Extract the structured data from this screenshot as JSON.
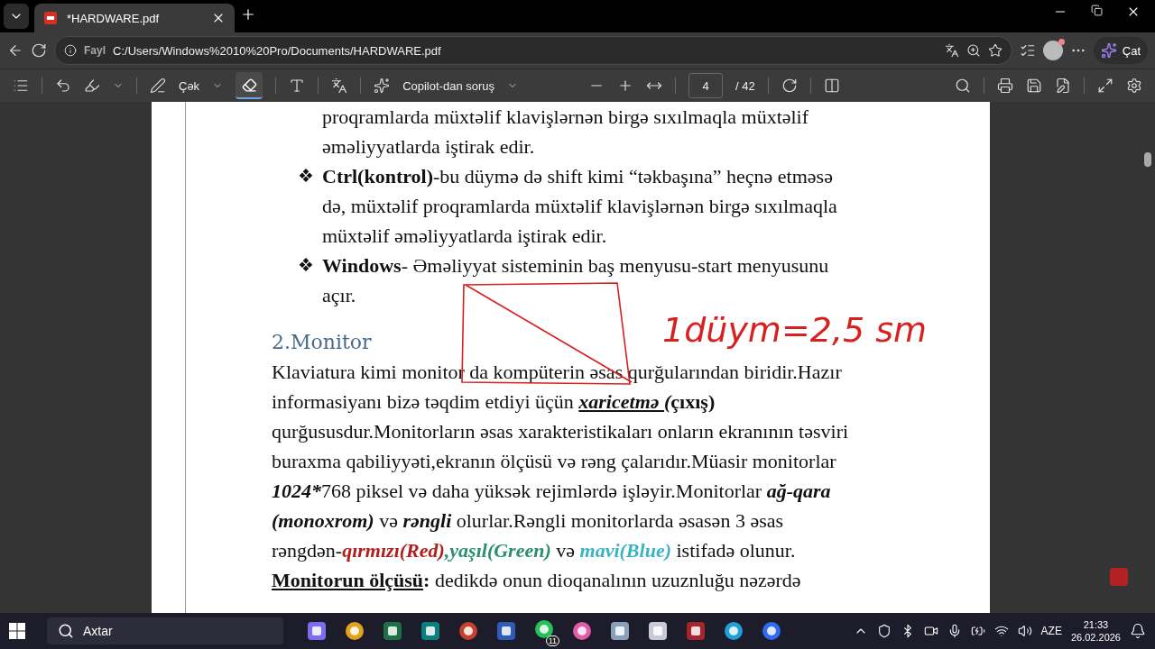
{
  "tabs": [
    {
      "title": "*HARDWARE.pdf",
      "selected": true
    }
  ],
  "address": {
    "label": "Fayl",
    "url": "C:/Users/Windows%2010%20Pro/Documents/HARDWARE.pdf"
  },
  "copilot_button": {
    "label": "Çat"
  },
  "pdf_toolbar": {
    "draw_label": "Çək",
    "eraser_selected": true,
    "ask_label": "Copilot-dan soruş",
    "page": "4",
    "page_total": "/ 42"
  },
  "document": {
    "blocks": [
      {
        "kind": "continuation",
        "lines": [
          [
            {
              "text": "proqramlarda müxtəlif klavişlərnən birgə sıxılmaqla müxtəlif",
              "bold": false,
              "italic": false,
              "underline": false
            }
          ],
          [
            {
              "text": "əməliyyatlarda iştirak edir.",
              "bold": false,
              "italic": false,
              "underline": false
            }
          ]
        ]
      },
      {
        "kind": "bullet",
        "symbol": "❖",
        "lines": [
          [
            {
              "text": "Ctrl(kontrol)",
              "bold": true,
              "italic": false,
              "underline": false
            },
            {
              "text": "-bu düymə də shift kimi  “təkbaşına” heçnə etməsə",
              "bold": false,
              "italic": false,
              "underline": false
            }
          ],
          [
            {
              "text": "də, müxtəlif proqramlarda müxtəlif klavişlərnən birgə sıxılmaqla",
              "bold": false,
              "italic": false,
              "underline": false
            }
          ],
          [
            {
              "text": "müxtəlif əməliyyatlarda iştirak edir.",
              "bold": false,
              "italic": false,
              "underline": false
            }
          ]
        ]
      },
      {
        "kind": "bullet",
        "symbol": "❖",
        "lines": [
          [
            {
              "text": "Windows",
              "bold": true,
              "italic": false,
              "underline": false
            },
            {
              "text": "- Əməliyyat sisteminin baş menyusu-start menyusunu",
              "bold": false,
              "italic": false,
              "underline": false
            }
          ],
          [
            {
              "text": "açır.",
              "bold": false,
              "italic": false,
              "underline": false
            }
          ]
        ]
      },
      {
        "kind": "heading",
        "lines": [
          [
            {
              "text": "2.Monitor",
              "bold": false,
              "italic": false,
              "underline": false
            }
          ]
        ]
      },
      {
        "kind": "paragraph",
        "lines": [
          [
            {
              "text": "Klaviatura kimi monitor da kompüterin əsas qurğularından biridir.Hazır",
              "bold": false,
              "italic": false,
              "underline": false
            }
          ],
          [
            {
              "text": "informasiyanı bizə təqdim etdiyi üçün ",
              "bold": false,
              "italic": false,
              "underline": false
            },
            {
              "text": "xaricetmə (",
              "bold": true,
              "italic": true,
              "underline": true
            },
            {
              "text": "çıxış)",
              "bold": true,
              "italic": false,
              "underline": false
            }
          ],
          [
            {
              "text": "qurğususdur.Monitorların əsas xarakteristikaları onların ekranının təsviri",
              "bold": false,
              "italic": false,
              "underline": false
            }
          ],
          [
            {
              "text": "buraxma qabiliyyəti,ekranın ölçüsü və rəng çalarıdır.Müasir monitorlar",
              "bold": false,
              "italic": false,
              "underline": false
            }
          ],
          [
            {
              "text": "1024*",
              "bold": true,
              "italic": true,
              "underline": false
            },
            {
              "text": "768 piksel və daha yüksək rejimlərdə işləyir.Monitorlar ",
              "bold": false,
              "italic": false,
              "underline": false
            },
            {
              "text": "ağ-qara",
              "bold": true,
              "italic": true,
              "underline": false
            }
          ],
          [
            {
              "text": "(monoxrom)",
              "bold": true,
              "italic": true,
              "underline": false
            },
            {
              "text": " və ",
              "bold": false,
              "italic": false,
              "underline": false
            },
            {
              "text": "rəngli",
              "bold": true,
              "italic": true,
              "underline": false
            },
            {
              "text": " olurlar.Rəngli monitorlarda əsasən 3 əsas",
              "bold": false,
              "italic": false,
              "underline": false
            }
          ],
          [
            {
              "text": "rəngdən-",
              "bold": false,
              "italic": false,
              "underline": false
            },
            {
              "text": "qırmızı(Red)",
              "bold": true,
              "italic": true,
              "underline": false,
              "color": "#b0201e"
            },
            {
              "text": ",yaşıl(Green)",
              "bold": true,
              "italic": true,
              "underline": false,
              "color": "#2a8f6c"
            },
            {
              "text": " və ",
              "bold": false,
              "italic": false,
              "underline": false
            },
            {
              "text": "mavi(Blue)",
              "bold": true,
              "italic": true,
              "underline": false,
              "color": "#3bb3c6"
            },
            {
              "text": " istifadə olunur.",
              "bold": false,
              "italic": false,
              "underline": false
            }
          ],
          [
            {
              "text": "Monitorun ölçüsü",
              "bold": true,
              "italic": false,
              "underline": true
            },
            {
              "text": ":",
              "bold": true,
              "italic": false,
              "underline": false
            },
            {
              "text": " dedikdə onun dioqanalının uzuznluğu nəzərdə",
              "bold": false,
              "italic": false,
              "underline": false
            }
          ]
        ]
      }
    ]
  },
  "ink_annotation": {
    "text": "1düym=2,5 sm"
  },
  "taskbar": {
    "search_placeholder": "Axtar",
    "chat_badge": "11",
    "language": "AZE",
    "time": "21:33",
    "date": "26.02.2026"
  }
}
